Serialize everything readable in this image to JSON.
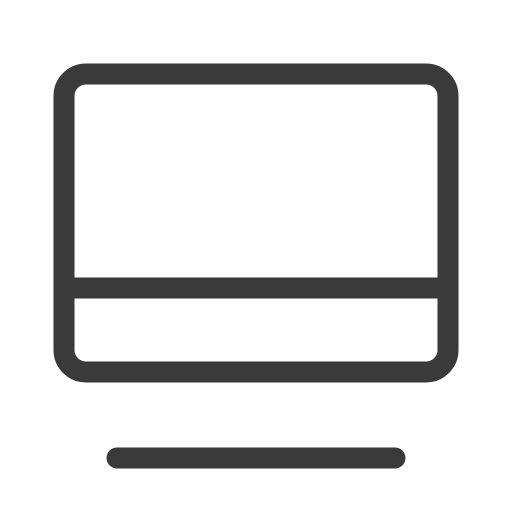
{
  "icon": {
    "name": "monitor-icon",
    "stroke_color": "#3a3a3a",
    "background_color": "#ffffff"
  }
}
